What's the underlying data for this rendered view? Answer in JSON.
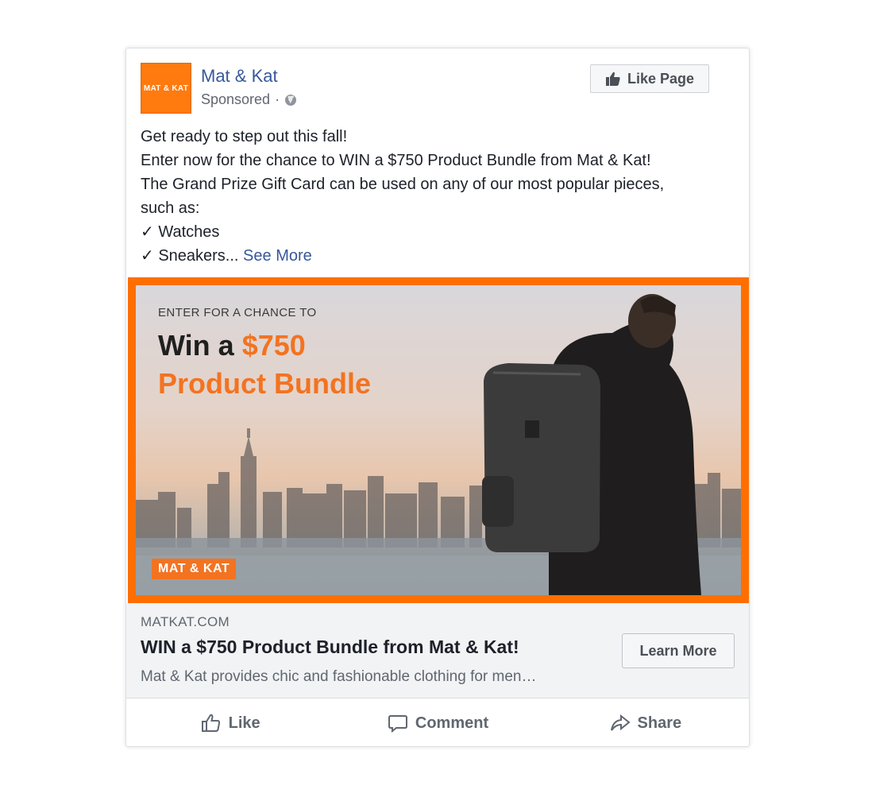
{
  "post": {
    "page_name": "Mat & Kat",
    "avatar_text": "MAT & KAT",
    "sponsored": "Sponsored",
    "separator": "·",
    "like_page_label": "Like Page",
    "text_lines": [
      "Get ready to step out this fall!",
      "Enter now for the chance to WIN a $750 Product Bundle from Mat & Kat!",
      "The Grand Prize Gift Card can be used on any of our most popular pieces,",
      "such as:",
      "✓ Watches"
    ],
    "last_line": "✓ Sneakers...",
    "see_more": "See More"
  },
  "ad": {
    "kicker": "ENTER FOR A CHANCE TO",
    "headline_prefix": "Win a ",
    "headline_amount": "$750",
    "headline_line2": "Product Bundle",
    "logo_text": "MAT & KAT",
    "accent_color": "#f37321"
  },
  "link": {
    "domain": "MATKAT.COM",
    "title": "WIN a $750 Product Bundle from Mat & Kat!",
    "description": "Mat & Kat provides chic and fashionable clothing for men…",
    "cta": "Learn More"
  },
  "actions": {
    "like": "Like",
    "comment": "Comment",
    "share": "Share"
  },
  "icons": {
    "globe": "globe-icon",
    "thumb": "thumbs-up-icon",
    "comment": "comment-bubble-icon",
    "share": "share-arrow-icon"
  }
}
